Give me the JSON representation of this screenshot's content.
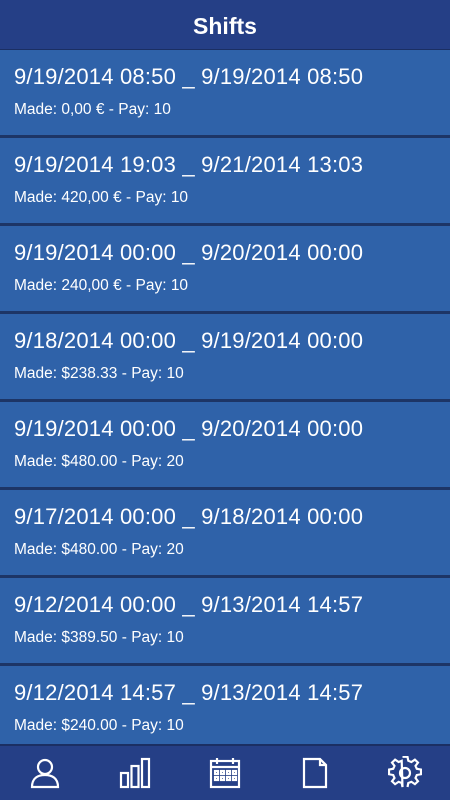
{
  "header": {
    "title": "Shifts"
  },
  "shifts": [
    {
      "range": "9/19/2014 08:50 _ 9/19/2014 08:50",
      "made": "Made: 0,00 € - Pay: 10"
    },
    {
      "range": "9/19/2014 19:03 _ 9/21/2014 13:03",
      "made": "Made: 420,00 € - Pay: 10"
    },
    {
      "range": "9/19/2014 00:00 _ 9/20/2014 00:00",
      "made": "Made: 240,00 € - Pay: 10"
    },
    {
      "range": "9/18/2014 00:00 _ 9/19/2014 00:00",
      "made": "Made: $238.33 - Pay: 10"
    },
    {
      "range": "9/19/2014 00:00 _ 9/20/2014 00:00",
      "made": "Made: $480.00 - Pay: 20"
    },
    {
      "range": "9/17/2014 00:00 _ 9/18/2014 00:00",
      "made": "Made: $480.00 - Pay: 20"
    },
    {
      "range": "9/12/2014 00:00 _ 9/13/2014 14:57",
      "made": "Made: $389.50 - Pay: 10"
    },
    {
      "range": "9/12/2014 14:57 _ 9/13/2014 14:57",
      "made": "Made: $240.00 - Pay: 10"
    }
  ],
  "tabbar": {
    "items": [
      {
        "icon": "person-icon"
      },
      {
        "icon": "bar-chart-icon"
      },
      {
        "icon": "calendar-icon"
      },
      {
        "icon": "document-icon"
      },
      {
        "icon": "gear-icon"
      }
    ]
  },
  "colors": {
    "header_bg": "#253f86",
    "row_bg": "#2f62a9",
    "row_divider": "#1d3566",
    "text": "#ffffff"
  }
}
